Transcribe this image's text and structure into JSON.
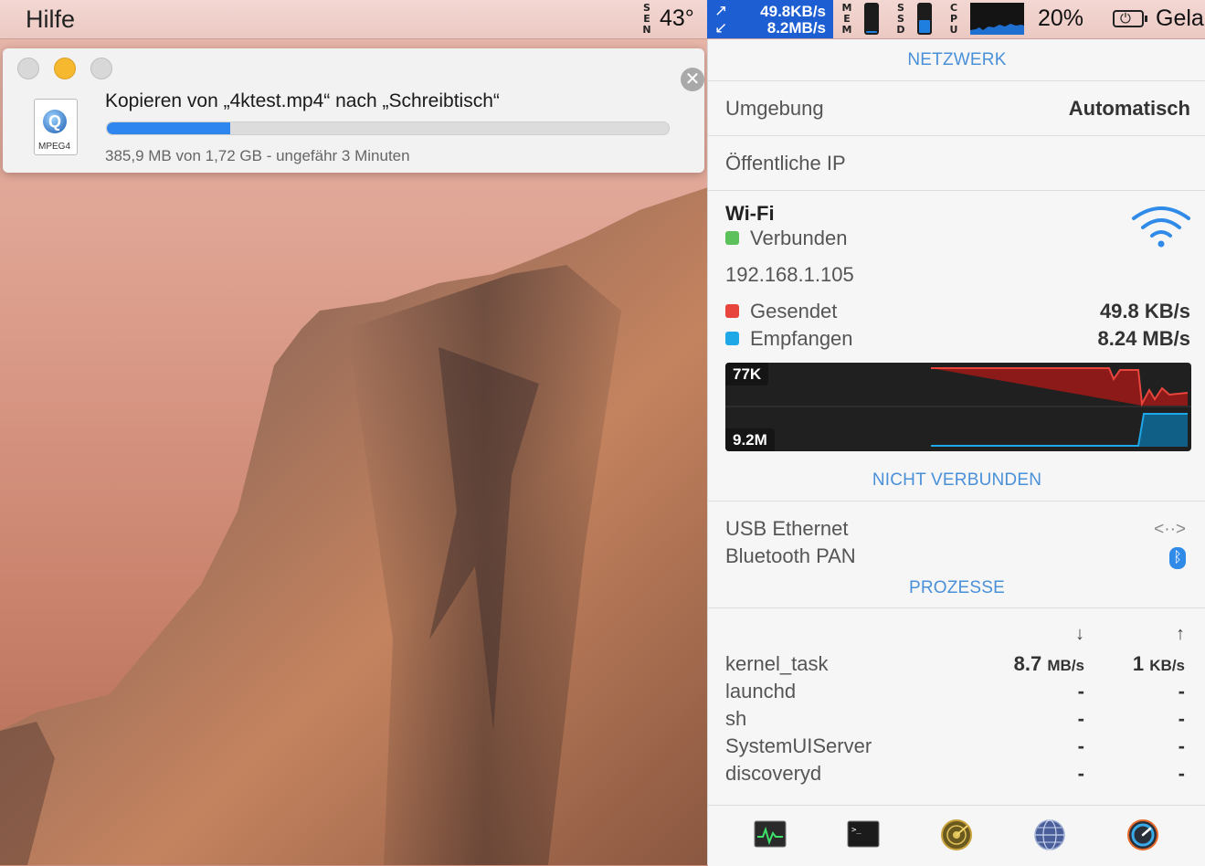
{
  "menubar": {
    "menu_label": "Hilfe",
    "sensor_letters": [
      "S",
      "E",
      "N"
    ],
    "sensor_value": "43°",
    "net_up": "49.8KB/s",
    "net_down": "8.2MB/s",
    "mem_letters": [
      "M",
      "E",
      "M"
    ],
    "mem_level": 0.08,
    "ssd_letters": [
      "S",
      "S",
      "D"
    ],
    "ssd_level": 0.45,
    "cpu_letters": [
      "C",
      "P",
      "U"
    ],
    "cpu_percent": "20%",
    "battery_text": "Gela"
  },
  "copy_window": {
    "title": "Kopieren von „4ktest.mp4“ nach „Schreibtisch“",
    "file_type": "MPEG4",
    "status": "385,9 MB von 1,72 GB - ungefähr 3 Minuten",
    "progress": 0.22
  },
  "panel": {
    "network_header": "NETZWERK",
    "environment_label": "Umgebung",
    "environment_value": "Automatisch",
    "public_ip_label": "Öffentliche IP",
    "wifi": {
      "title": "Wi-Fi",
      "status": "Verbunden",
      "ip": "192.168.1.105",
      "sent_label": "Gesendet",
      "sent_value": "49.8 KB/s",
      "received_label": "Empfangen",
      "received_value": "8.24 MB/s",
      "graph_top_label": "77K",
      "graph_bottom_label": "9.2M"
    },
    "not_connected_header": "NICHT VERBUNDEN",
    "not_connected": [
      "USB Ethernet",
      "Bluetooth PAN"
    ],
    "processes_header": "PROZESSE",
    "processes": [
      {
        "name": "kernel_task",
        "down": "8.7",
        "down_unit": "MB/s",
        "up": "1",
        "up_unit": "KB/s"
      },
      {
        "name": "launchd",
        "down": "-",
        "down_unit": "",
        "up": "-",
        "up_unit": ""
      },
      {
        "name": "sh",
        "down": "-",
        "down_unit": "",
        "up": "-",
        "up_unit": ""
      },
      {
        "name": "SystemUIServer",
        "down": "-",
        "down_unit": "",
        "up": "-",
        "up_unit": ""
      },
      {
        "name": "discoveryd",
        "down": "-",
        "down_unit": "",
        "up": "-",
        "up_unit": ""
      }
    ]
  },
  "colors": {
    "accent": "#4a90d9",
    "sent": "#e8453c",
    "received": "#1fa8e8",
    "connected": "#5cc15a",
    "net_box": "#1d5fd3"
  }
}
